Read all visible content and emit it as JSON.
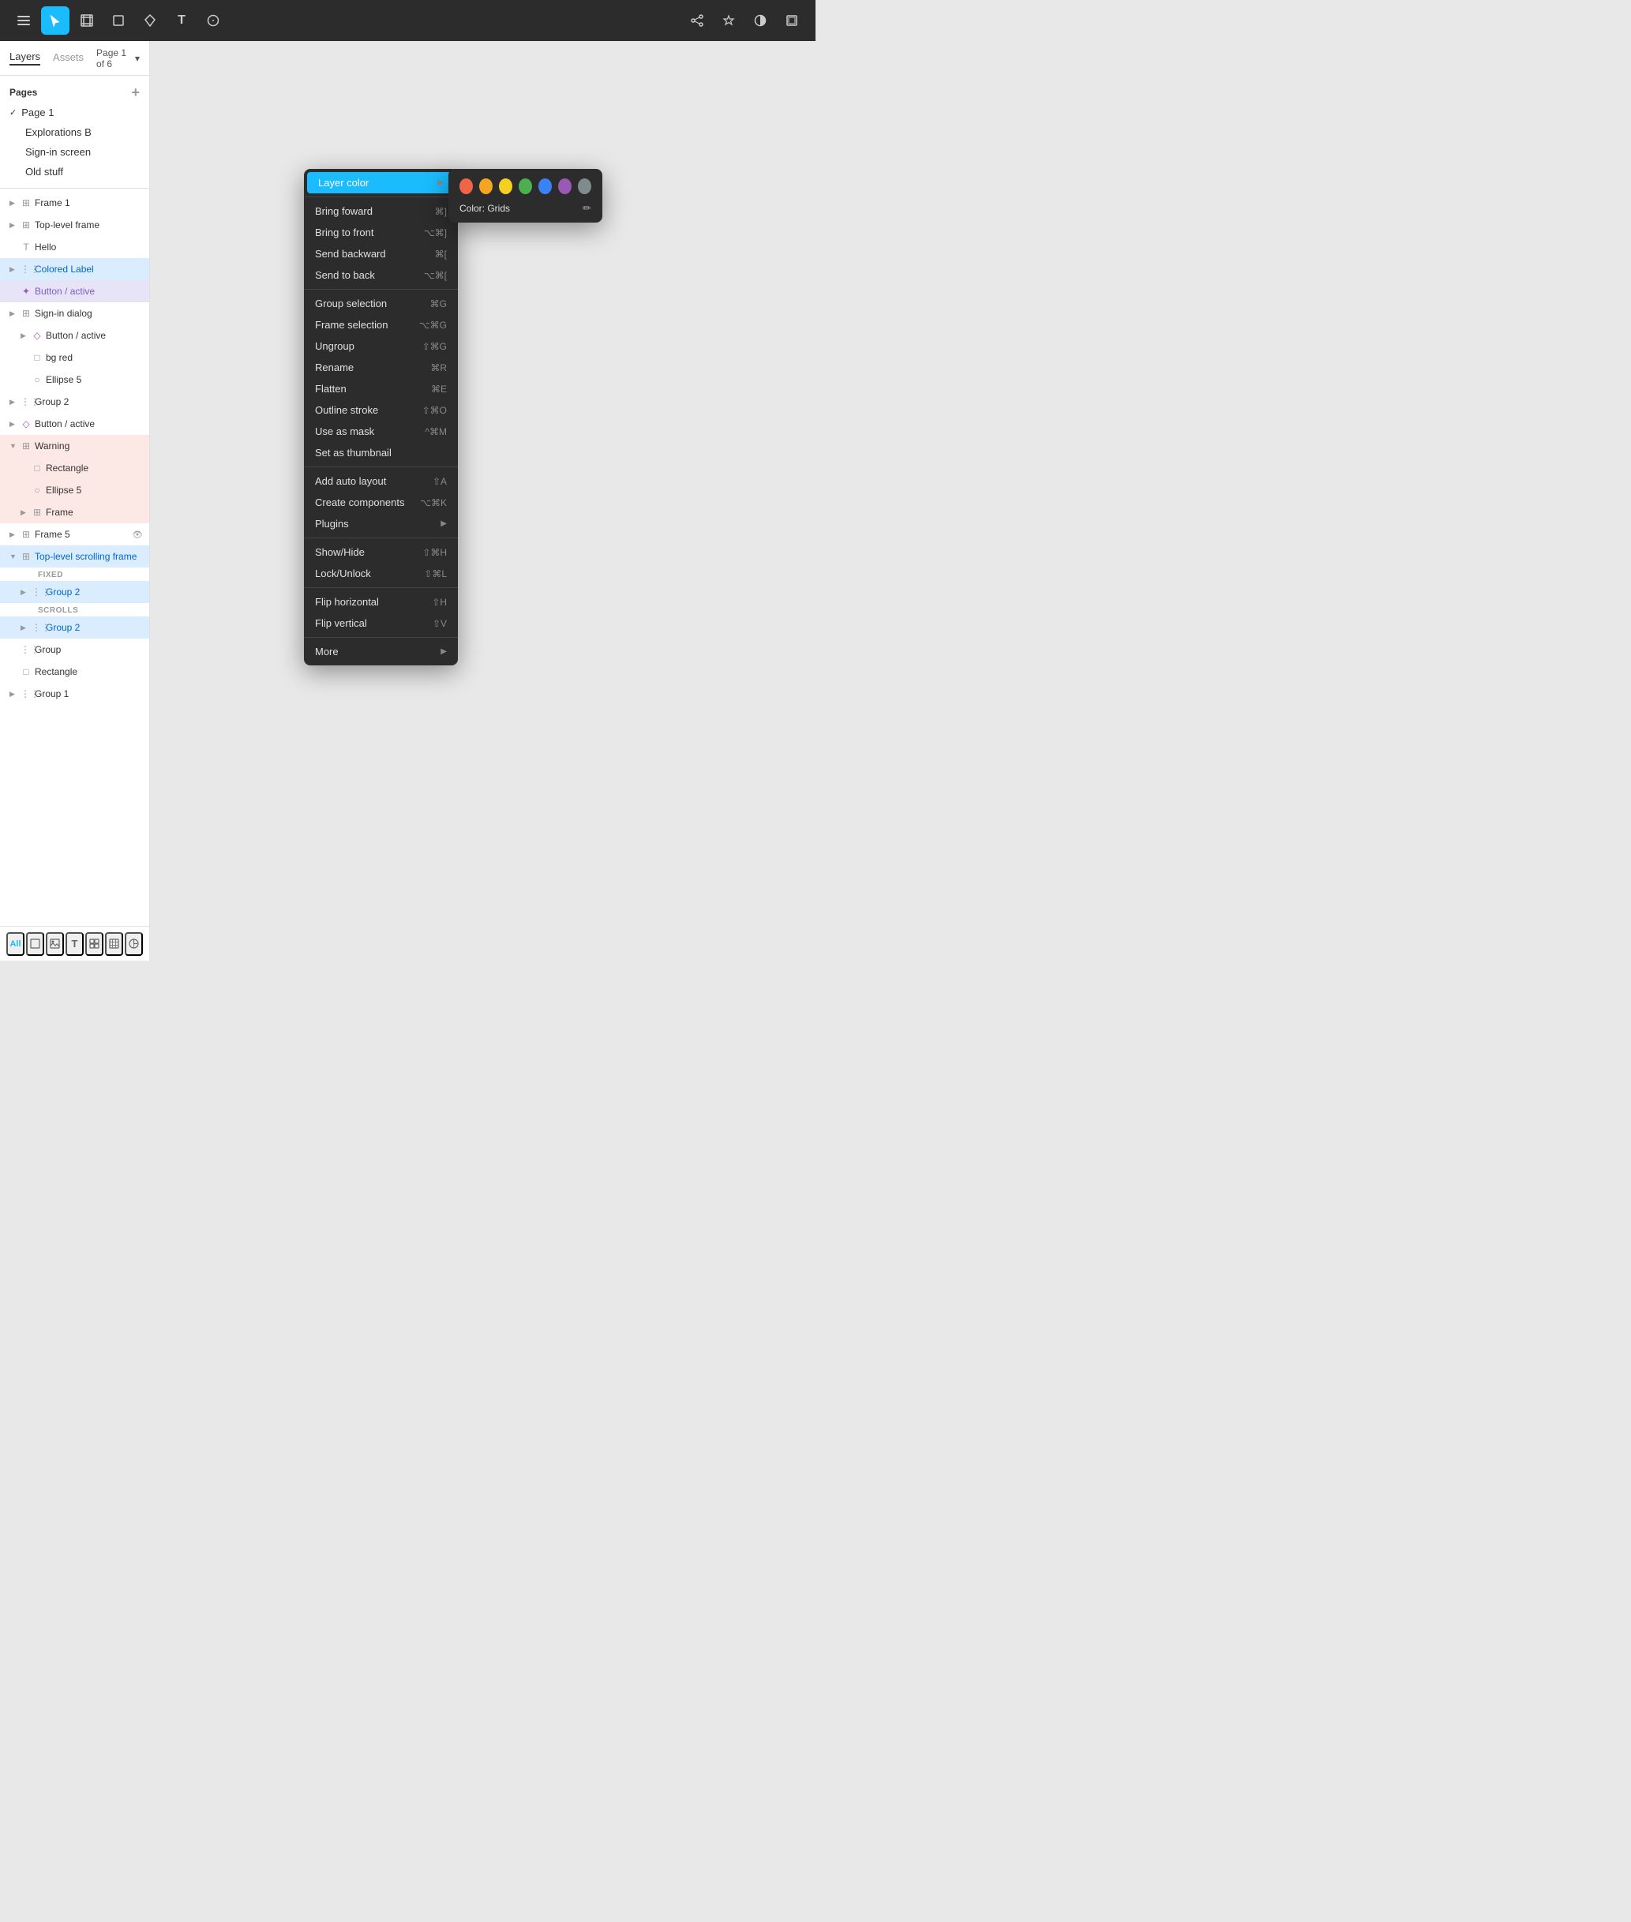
{
  "toolbar": {
    "menu_label": "☰",
    "cursor_label": "↖",
    "grid_label": "#",
    "rect_label": "□",
    "pen_label": "✒",
    "text_label": "T",
    "bubble_label": "○",
    "rotate_label": "↺",
    "star_label": "✦",
    "contrast_label": "◑",
    "layers_label": "⬜"
  },
  "sidebar": {
    "tabs": [
      {
        "label": "Layers",
        "active": true
      },
      {
        "label": "Assets",
        "active": false
      }
    ],
    "page_selector": "Page 1 of 6",
    "pages_header": "Pages",
    "pages_add": "+",
    "pages": [
      {
        "label": "Page 1",
        "active": true
      },
      {
        "label": "Explorations B",
        "active": false
      },
      {
        "label": "Sign-in screen",
        "active": false
      },
      {
        "label": "Old stuff",
        "active": false
      }
    ],
    "layers": [
      {
        "id": "frame1",
        "indent": 0,
        "icon": "⊞",
        "icon_color": "frame",
        "name": "Frame 1",
        "chevron": "▶",
        "selected": false
      },
      {
        "id": "toplevel",
        "indent": 0,
        "icon": "⊞",
        "icon_color": "frame",
        "name": "Top-level frame",
        "chevron": "▶",
        "selected": false
      },
      {
        "id": "hello",
        "indent": 0,
        "icon": "T",
        "icon_color": "normal",
        "name": "Hello",
        "chevron": "",
        "selected": false
      },
      {
        "id": "colored-label",
        "indent": 0,
        "icon": "⋮⋮",
        "icon_color": "normal",
        "name": "Colored Label",
        "chevron": "▶",
        "selected": true,
        "style": "selected"
      },
      {
        "id": "button-active1",
        "indent": 0,
        "icon": "✦",
        "icon_color": "purple",
        "name": "Button / active",
        "chevron": "",
        "selected": false,
        "style": "selected-purple"
      },
      {
        "id": "signin-dialog",
        "indent": 0,
        "icon": "⊞",
        "icon_color": "frame",
        "name": "Sign-in dialog",
        "chevron": "▶",
        "selected": false
      },
      {
        "id": "button-active2",
        "indent": 1,
        "icon": "◇",
        "icon_color": "purple",
        "name": "Button / active",
        "chevron": "▶",
        "selected": false
      },
      {
        "id": "bg-red",
        "indent": 1,
        "icon": "□",
        "icon_color": "normal",
        "name": "bg red",
        "chevron": "",
        "selected": false
      },
      {
        "id": "ellipse5",
        "indent": 1,
        "icon": "○",
        "icon_color": "normal",
        "name": "Ellipse 5",
        "chevron": "",
        "selected": false
      },
      {
        "id": "group2a",
        "indent": 0,
        "icon": "⋮⋮",
        "icon_color": "normal",
        "name": "Group 2",
        "chevron": "▶",
        "selected": false
      },
      {
        "id": "button-active3",
        "indent": 0,
        "icon": "◇",
        "icon_color": "purple",
        "name": "Button / active",
        "chevron": "▶",
        "selected": false
      },
      {
        "id": "warning",
        "indent": 0,
        "icon": "⊞",
        "icon_color": "frame",
        "name": "Warning",
        "chevron": "▼",
        "selected": false,
        "style": "highlighted-red"
      },
      {
        "id": "rectangle",
        "indent": 1,
        "icon": "□",
        "icon_color": "normal",
        "name": "Rectangle",
        "chevron": "",
        "selected": false,
        "style": "highlighted-red"
      },
      {
        "id": "ellipse5b",
        "indent": 1,
        "icon": "○",
        "icon_color": "normal",
        "name": "Ellipse 5",
        "chevron": "",
        "selected": false,
        "style": "highlighted-red"
      },
      {
        "id": "frameb",
        "indent": 1,
        "icon": "⊞",
        "icon_color": "frame",
        "name": "Frame",
        "chevron": "▶",
        "selected": false,
        "style": "highlighted-red"
      },
      {
        "id": "frame5",
        "indent": 0,
        "icon": "⊞",
        "icon_color": "frame",
        "name": "Frame 5",
        "chevron": "▶",
        "selected": false
      },
      {
        "id": "toplevel-scroll",
        "indent": 0,
        "icon": "⊞",
        "icon_color": "frame",
        "name": "Top-level scrolling frame",
        "chevron": "▼",
        "selected": false,
        "style": "selected"
      },
      {
        "id": "fixed-label",
        "indent": 0,
        "is_section": true,
        "name": "FIXED"
      },
      {
        "id": "group2b",
        "indent": 1,
        "icon": "⋮⋮",
        "icon_color": "normal",
        "name": "Group 2",
        "chevron": "▶",
        "selected": false,
        "style": "selected"
      },
      {
        "id": "scrolls-label",
        "indent": 0,
        "is_section": true,
        "name": "SCROLLS"
      },
      {
        "id": "group2c",
        "indent": 1,
        "icon": "⋮⋮",
        "icon_color": "normal",
        "name": "Group 2",
        "chevron": "▶",
        "selected": false,
        "style": "selected"
      },
      {
        "id": "group",
        "indent": 0,
        "icon": "⋮⋮",
        "icon_color": "normal",
        "name": "Group",
        "chevron": "",
        "selected": false
      },
      {
        "id": "rectangle2",
        "indent": 0,
        "icon": "□",
        "icon_color": "normal",
        "name": "Rectangle",
        "chevron": "",
        "selected": false
      },
      {
        "id": "group1",
        "indent": 0,
        "icon": "⋮⋮",
        "icon_color": "normal",
        "name": "Group 1",
        "chevron": "▶",
        "selected": false
      }
    ],
    "bottom_tools": [
      "All",
      "⬜",
      "🖼",
      "T",
      "⊞",
      "#",
      "✦"
    ]
  },
  "context_menu": {
    "items": [
      {
        "id": "layer-color",
        "label": "Layer color",
        "shortcut": "",
        "arrow": "▶",
        "highlighted": true
      },
      {
        "id": "sep1",
        "separator": true
      },
      {
        "id": "bring-forward",
        "label": "Bring foward",
        "shortcut": "⌘]",
        "arrow": ""
      },
      {
        "id": "bring-to-front",
        "label": "Bring to front",
        "shortcut": "⌥⌘]",
        "arrow": ""
      },
      {
        "id": "send-backward",
        "label": "Send backward",
        "shortcut": "⌘[",
        "arrow": ""
      },
      {
        "id": "send-to-back",
        "label": "Send to back",
        "shortcut": "⌥⌘[",
        "arrow": ""
      },
      {
        "id": "sep2",
        "separator": true
      },
      {
        "id": "group-selection",
        "label": "Group selection",
        "shortcut": "⌘G",
        "arrow": ""
      },
      {
        "id": "frame-selection",
        "label": "Frame selection",
        "shortcut": "⌥⌘G",
        "arrow": ""
      },
      {
        "id": "ungroup",
        "label": "Ungroup",
        "shortcut": "⇧⌘G",
        "arrow": ""
      },
      {
        "id": "rename",
        "label": "Rename",
        "shortcut": "⌘R",
        "arrow": ""
      },
      {
        "id": "flatten",
        "label": "Flatten",
        "shortcut": "⌘E",
        "arrow": ""
      },
      {
        "id": "outline-stroke",
        "label": "Outline stroke",
        "shortcut": "⇧⌘O",
        "arrow": ""
      },
      {
        "id": "use-as-mask",
        "label": "Use as mask",
        "shortcut": "^⌘M",
        "arrow": ""
      },
      {
        "id": "set-thumbnail",
        "label": "Set as thumbnail",
        "shortcut": "",
        "arrow": ""
      },
      {
        "id": "sep3",
        "separator": true
      },
      {
        "id": "add-auto-layout",
        "label": "Add auto layout",
        "shortcut": "⇧A",
        "arrow": ""
      },
      {
        "id": "create-components",
        "label": "Create components",
        "shortcut": "⌥⌘K",
        "arrow": ""
      },
      {
        "id": "plugins",
        "label": "Plugins",
        "shortcut": "",
        "arrow": "▶"
      },
      {
        "id": "sep4",
        "separator": true
      },
      {
        "id": "show-hide",
        "label": "Show/Hide",
        "shortcut": "⇧⌘H",
        "arrow": ""
      },
      {
        "id": "lock-unlock",
        "label": "Lock/Unlock",
        "shortcut": "⇧⌘L",
        "arrow": ""
      },
      {
        "id": "sep5",
        "separator": true
      },
      {
        "id": "flip-horizontal",
        "label": "Flip horizontal",
        "shortcut": "⇧H",
        "arrow": ""
      },
      {
        "id": "flip-vertical",
        "label": "Flip vertical",
        "shortcut": "⇧V",
        "arrow": ""
      },
      {
        "id": "sep6",
        "separator": true
      },
      {
        "id": "more",
        "label": "More",
        "shortcut": "",
        "arrow": "▶"
      }
    ]
  },
  "layer_color_submenu": {
    "colors": [
      {
        "id": "red",
        "hex": "#f06548"
      },
      {
        "id": "orange",
        "hex": "#f4a623"
      },
      {
        "id": "yellow",
        "hex": "#f5d020"
      },
      {
        "id": "green",
        "hex": "#4caf50"
      },
      {
        "id": "blue",
        "hex": "#3b82f6"
      },
      {
        "id": "purple",
        "hex": "#9b59b6"
      },
      {
        "id": "gray",
        "hex": "#7f8c8d"
      }
    ],
    "label": "Color: Grids",
    "edit_icon": "✏"
  }
}
